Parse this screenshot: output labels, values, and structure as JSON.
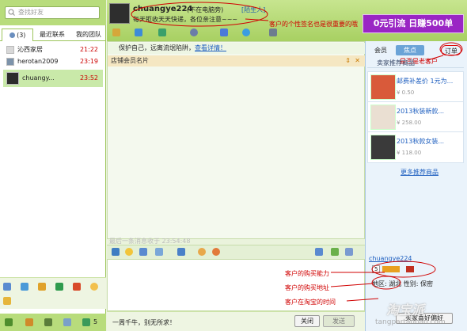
{
  "left": {
    "search_placeholder": "查找好友",
    "tabs": [
      {
        "label": "(3)"
      },
      {
        "label": "最近联系"
      },
      {
        "label": "我的团队"
      }
    ],
    "contacts": [
      {
        "name": "沁西家居",
        "time": "21:22"
      },
      {
        "name": "herotan2009",
        "time": "23:19"
      },
      {
        "name": "chuangy...",
        "time": "23:52"
      }
    ],
    "bottom_count": "5"
  },
  "header": {
    "username": "chuangye224",
    "status": "(不在电脑旁)",
    "stranger": "[陌生人]",
    "signature": "每天拒收天天快递，各位亲注意~~~",
    "annotation": "客户的个性签名也是很重要的哦",
    "ad_text": "0元引流  日赚500单"
  },
  "chat": {
    "security_notice": "保护自己，远离流氓陷阱，",
    "security_link": "查看详情！",
    "member_card": "店铺会员名片",
    "last_message": "最后一条消息收于 23:54:48",
    "slogan": "一周千牛，别无所求！",
    "close_label": "关闭",
    "send_label": "发送"
  },
  "annotations": {
    "buy_power": "客户的购买能力",
    "buy_address": "客户的购买地址",
    "taobao_time": "客户在淘宝的时间",
    "recommend": "是否是老客户"
  },
  "right": {
    "tabs": [
      {
        "label": "会员"
      },
      {
        "label": "焦点"
      },
      {
        "label": "订单"
      }
    ],
    "reco_header": "卖家推荐商品",
    "items": [
      {
        "name": "邮费补差价 1元为...",
        "price": "¥ 0.50"
      },
      {
        "name": "2013秋装新款...",
        "price": "¥ 258.00"
      },
      {
        "name": "2013秋款女装...",
        "price": "¥ 118.00"
      }
    ],
    "more_label": "更多推荐商品",
    "customer": {
      "name": "chuangye224",
      "level": "5",
      "region_label": "地区:",
      "region": "湖北",
      "gender_label": "性别:",
      "gender": "保密",
      "buyer_pref": "买家喜好偏好"
    }
  },
  "watermark": "淘宝派",
  "watermark_url": "tangpartaobao.com",
  "colors": {
    "accent": "#9cc45a",
    "annotation": "#d00000",
    "link": "#2060c0"
  }
}
